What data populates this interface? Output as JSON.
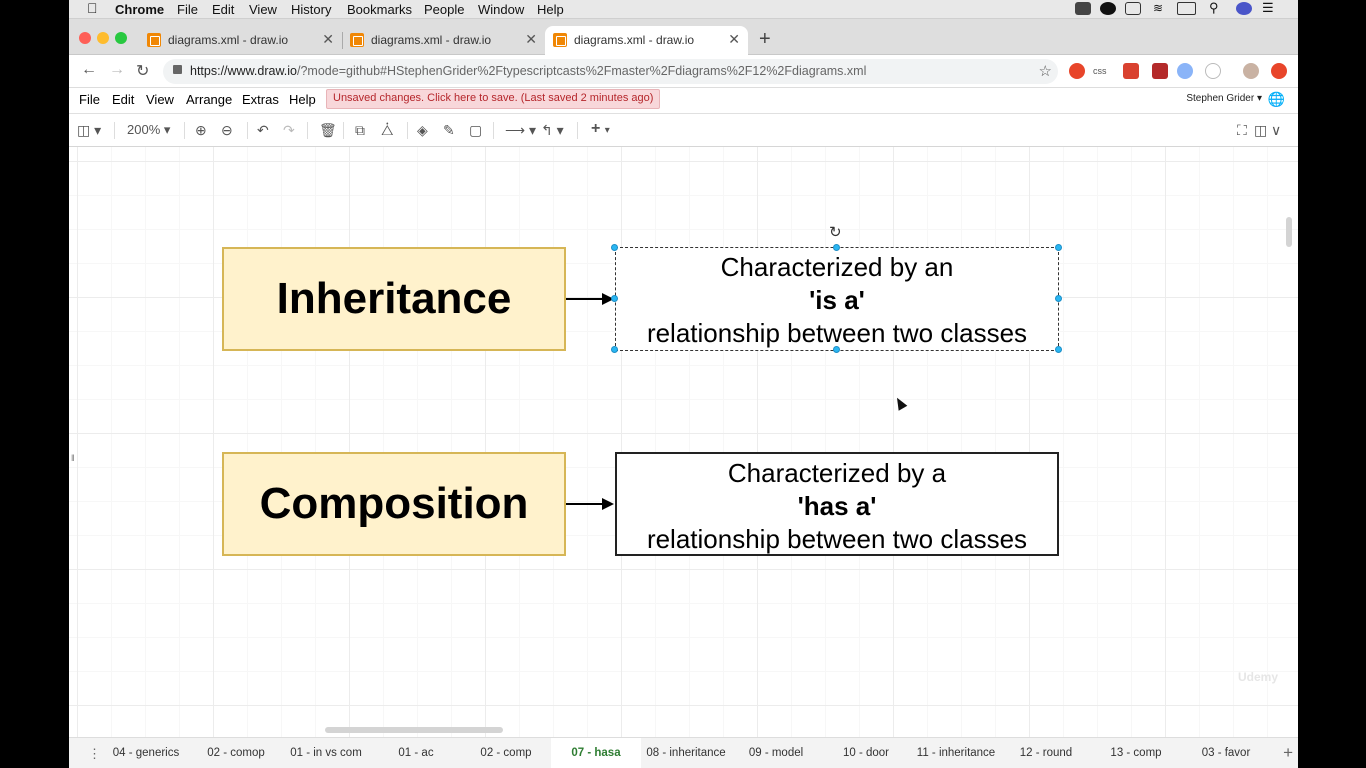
{
  "mac_menu": {
    "app": "Chrome",
    "items": [
      "File",
      "Edit",
      "View",
      "History",
      "Bookmarks",
      "People",
      "Window",
      "Help"
    ]
  },
  "browser": {
    "tabs": [
      {
        "title": "diagrams.xml - draw.io"
      },
      {
        "title": "diagrams.xml - draw.io"
      },
      {
        "title": "diagrams.xml - draw.io"
      }
    ],
    "active_tab": 2,
    "url_host": "https://www.draw.io",
    "url_path": "/?mode=github#HStephenGrider%2Ftypescriptcasts%2Fmaster%2Fdiagrams%2F12%2Fdiagrams.xml",
    "ext_css": "css"
  },
  "drawio": {
    "menu": [
      "File",
      "Edit",
      "View",
      "Arrange",
      "Extras",
      "Help"
    ],
    "unsaved": "Unsaved changes. Click here to save. (Last saved 2 minutes ago)",
    "user": "Stephen Grider",
    "zoom": "200%"
  },
  "diagram": {
    "box1_title": "Inheritance",
    "box1_line1": "Characterized by an",
    "box1_line2": "'is a'",
    "box1_line3": "relationship between two classes",
    "box2_title": "Composition",
    "box2_line1": "Characterized by a",
    "box2_line2": "'has a'",
    "box2_line3": "relationship between two classes",
    "watermark": "Udemy"
  },
  "page_tabs": [
    {
      "label": "04 - generics"
    },
    {
      "label": "02 - comop"
    },
    {
      "label": "01 - in vs com"
    },
    {
      "label": "01 - ac"
    },
    {
      "label": "02 - comp"
    },
    {
      "label": "07 - hasa"
    },
    {
      "label": "08 - inheritance"
    },
    {
      "label": "09 - model"
    },
    {
      "label": "10 - door"
    },
    {
      "label": "11 - inheritance"
    },
    {
      "label": "12 - round"
    },
    {
      "label": "13 - comp"
    },
    {
      "label": "03 - favor"
    }
  ],
  "active_page": "07 - hasa",
  "colors": {
    "box_fill": "#fff2cc",
    "box_border": "#d6b656",
    "selection": "#29b6f2",
    "unsaved_bg": "#f8d7da",
    "active_page_text": "#2e7d32"
  }
}
